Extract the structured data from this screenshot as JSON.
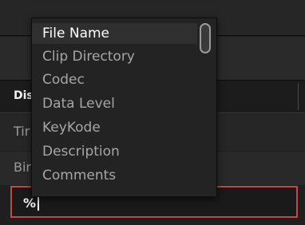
{
  "table": {
    "column_header": "Dis",
    "rows": [
      "Tir",
      "Bir"
    ]
  },
  "search_field": {
    "value": "%"
  },
  "dropdown": {
    "items": [
      "File Name",
      "Clip Directory",
      "Codec",
      "Data Level",
      "KeyKode",
      "Description",
      "Comments"
    ],
    "selected": "File Name"
  },
  "colors": {
    "field_border": "#c8463e",
    "background": "#1f1f1f"
  }
}
